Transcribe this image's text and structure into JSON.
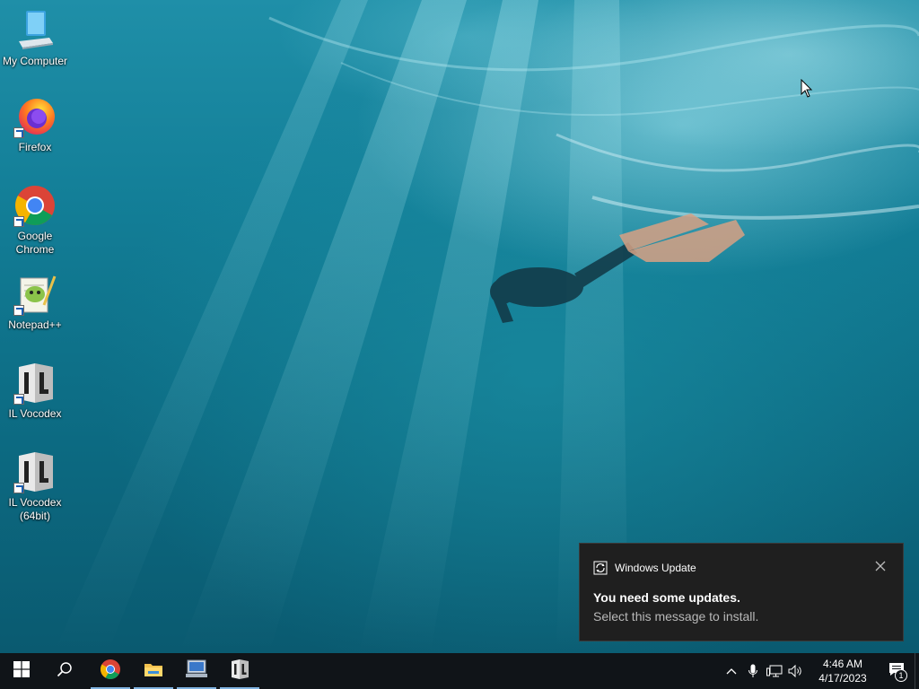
{
  "desktop": {
    "icons": [
      {
        "label": "My Computer",
        "icon": "computer-icon"
      },
      {
        "label": "Firefox",
        "icon": "firefox-icon"
      },
      {
        "label": "Google\nChrome",
        "icon": "chrome-icon"
      },
      {
        "label": "Notepad++",
        "icon": "notepad-plus-plus-icon"
      },
      {
        "label": "IL Vocodex",
        "icon": "il-vocodex-icon"
      },
      {
        "label": "IL Vocodex\n(64bit)",
        "icon": "il-vocodex-64-icon"
      }
    ]
  },
  "toast": {
    "app_name": "Windows Update",
    "title": "You need some updates.",
    "body": "Select this message to install."
  },
  "taskbar": {
    "pinned": [
      "start-icon",
      "search-icon",
      "chrome-icon",
      "file-explorer-icon",
      "network-app-icon",
      "il-vocodex-icon"
    ],
    "tray_icons": [
      "chevron-up-icon",
      "microphone-icon",
      "network-icon",
      "volume-icon"
    ],
    "time": "4:46 AM",
    "date": "4/17/2023",
    "notification_count": "1"
  },
  "colors": {
    "taskbar": "#101418",
    "toast_bg": "#1f1f1f",
    "active_indicator": "#7fb2e0"
  }
}
